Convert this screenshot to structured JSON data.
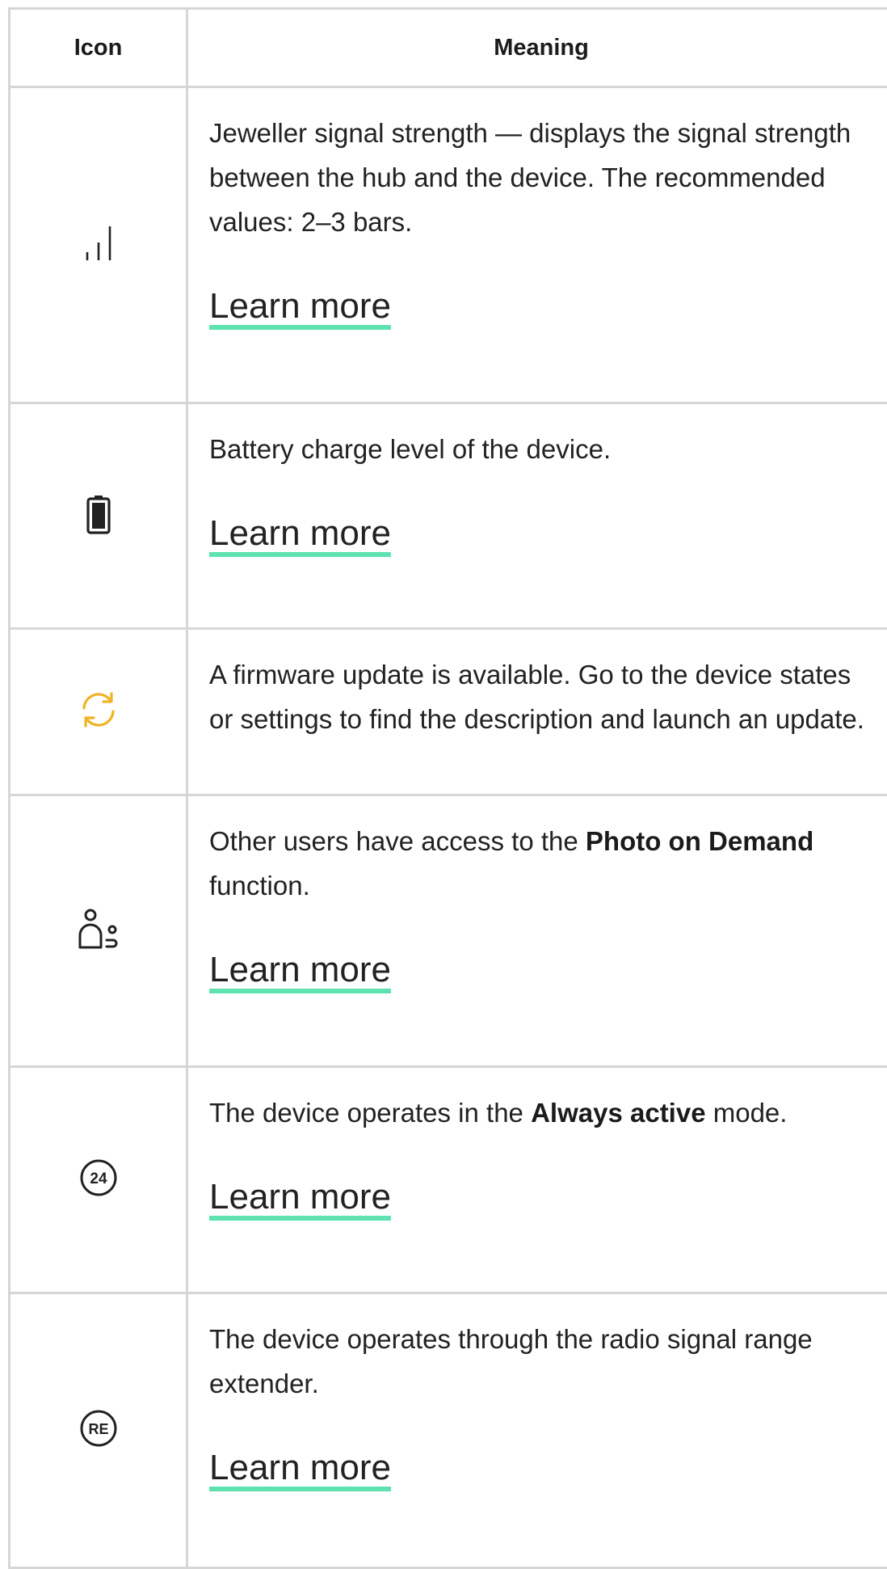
{
  "table": {
    "headers": {
      "icon": "Icon",
      "meaning": "Meaning"
    },
    "rows": [
      {
        "icon": "signal-strength-icon",
        "desc_parts": [
          "Jeweller signal strength — displays the signal strength between the hub and the device. The recommended values: 2–3 bars."
        ],
        "link": "Learn more"
      },
      {
        "icon": "battery-icon",
        "desc_parts": [
          "Battery charge level of the device."
        ],
        "link": "Learn more"
      },
      {
        "icon": "firmware-update-icon",
        "desc_parts": [
          "A firmware update is available. Go to the device states or settings to find the description and launch an update."
        ],
        "link": null
      },
      {
        "icon": "shared-users-icon",
        "desc_parts": [
          "Other users have access to the ",
          "Photo on Demand",
          " function."
        ],
        "link": "Learn more"
      },
      {
        "icon": "always-active-24-icon",
        "icon_text": "24",
        "desc_parts": [
          "The device operates in the ",
          "Always active",
          " mode."
        ],
        "link": "Learn more"
      },
      {
        "icon": "range-extender-re-icon",
        "icon_text": "RE",
        "desc_parts": [
          "The device operates through the radio signal range extender."
        ],
        "link": "Learn more"
      }
    ]
  },
  "colors": {
    "link_underline": "#5ee3b0",
    "update_icon": "#f0b323",
    "border": "#d6d6d6"
  }
}
